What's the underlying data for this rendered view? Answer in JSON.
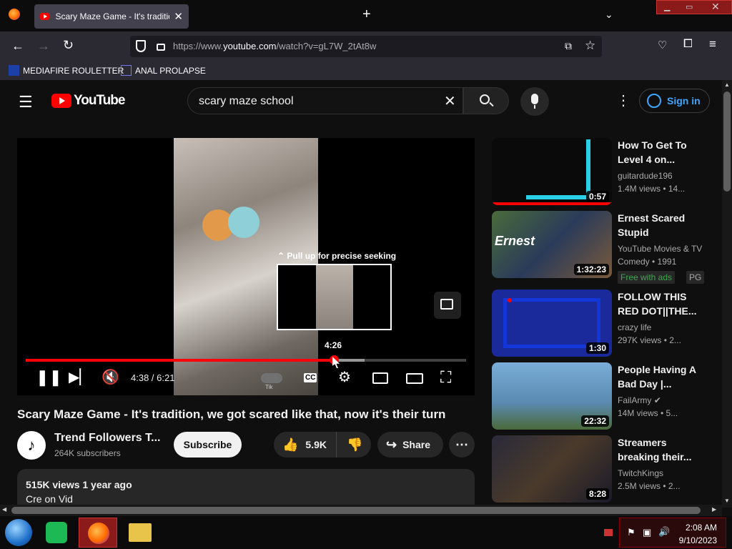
{
  "browser": {
    "tab_title": "Scary Maze Game - It's tradition",
    "new_tab": "+",
    "url_prefix": "https://www.",
    "url_domain": "youtube.com",
    "url_suffix": "/watch?v=gL7W_2tAt8w",
    "bookmarks": [
      {
        "label": "MEDIAFIRE ROULETTER"
      },
      {
        "label": "ANAL PROLAPSE"
      }
    ]
  },
  "youtube": {
    "logo_text": "YouTube",
    "search_value": "scary maze school",
    "sign_in": "Sign in"
  },
  "player": {
    "progress": 0.7,
    "buffered": 0.77,
    "current_time": "4:38 / 6:21",
    "seek_hint": "Pull up for precise seeking",
    "seek_time": "4:26",
    "cc": "CC"
  },
  "video": {
    "title": "Scary Maze Game - It's tradition, we got scared like that, now it's their turn",
    "channel": "Trend Followers T...",
    "subscribers": "264K subscribers",
    "subscribe": "Subscribe",
    "likes": "5.9K",
    "share": "Share",
    "views_date": "515K views  1 year ago",
    "description": "Cre on Vid"
  },
  "recommendations": [
    {
      "title": "How To Get To Level 4 on...",
      "channel": "guitardude196",
      "stats": "1.4M views  •  14...",
      "duration": "0:57",
      "thumb_color": "#0a0a0a"
    },
    {
      "title": "Ernest Scared Stupid",
      "channel": "YouTube Movies & TV",
      "channel2": "Comedy • 1991",
      "duration": "1:32:23",
      "badge1": "Free with ads",
      "badge2": "PG",
      "thumb_color": "#4a6b3a"
    },
    {
      "title": "FOLLOW THIS RED DOT||THE...",
      "channel": "crazy life",
      "stats": "297K views  •  2...",
      "duration": "1:30",
      "thumb_color": "#1a2a9a"
    },
    {
      "title": "People Having A Bad Day |...",
      "channel": "FailArmy",
      "stats": "14M views  •  5...",
      "duration": "22:32",
      "thumb_color": "#5a8ab0"
    },
    {
      "title": "Streamers breaking their...",
      "channel": "TwitchKings",
      "stats": "2.5M views  •  2...",
      "duration": "8:28",
      "thumb_color": "#2a2a3a"
    }
  ],
  "taskbar": {
    "time": "2:08 AM",
    "date": "9/10/2023"
  }
}
